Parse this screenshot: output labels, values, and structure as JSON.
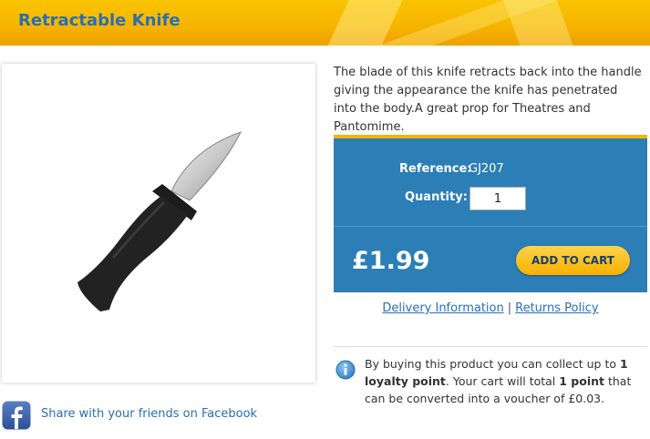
{
  "header": {
    "title": "Retractable Knife"
  },
  "product": {
    "description": "The blade of this knife retracts back into the handle giving the appearance the knife has penetrated into the body.A great prop for Theatres and Pantomime.",
    "reference_label": "Reference:",
    "reference_value": "GJ207",
    "quantity_label": "Quantity:",
    "quantity_value": "1",
    "price": "£1.99",
    "add_to_cart_label": "ADD TO CART"
  },
  "links": {
    "delivery": "Delivery Information",
    "separator": "|",
    "returns": "Returns Policy"
  },
  "loyalty": {
    "text_before": "By buying this product you can collect up to ",
    "points_collect": "1 loyalty point",
    "text_middle": ". Your cart will total ",
    "points_total": "1 point",
    "text_after": " that can be converted into a voucher of £0.03."
  },
  "social": {
    "facebook_label": "Share with your friends on Facebook"
  },
  "icons": {
    "info": "info-icon",
    "facebook": "facebook-icon"
  },
  "colors": {
    "header_yellow": "#f6b400",
    "panel_blue": "#2b7eb6",
    "link_blue": "#2a6fb0",
    "button_yellow": "#f5b000"
  }
}
